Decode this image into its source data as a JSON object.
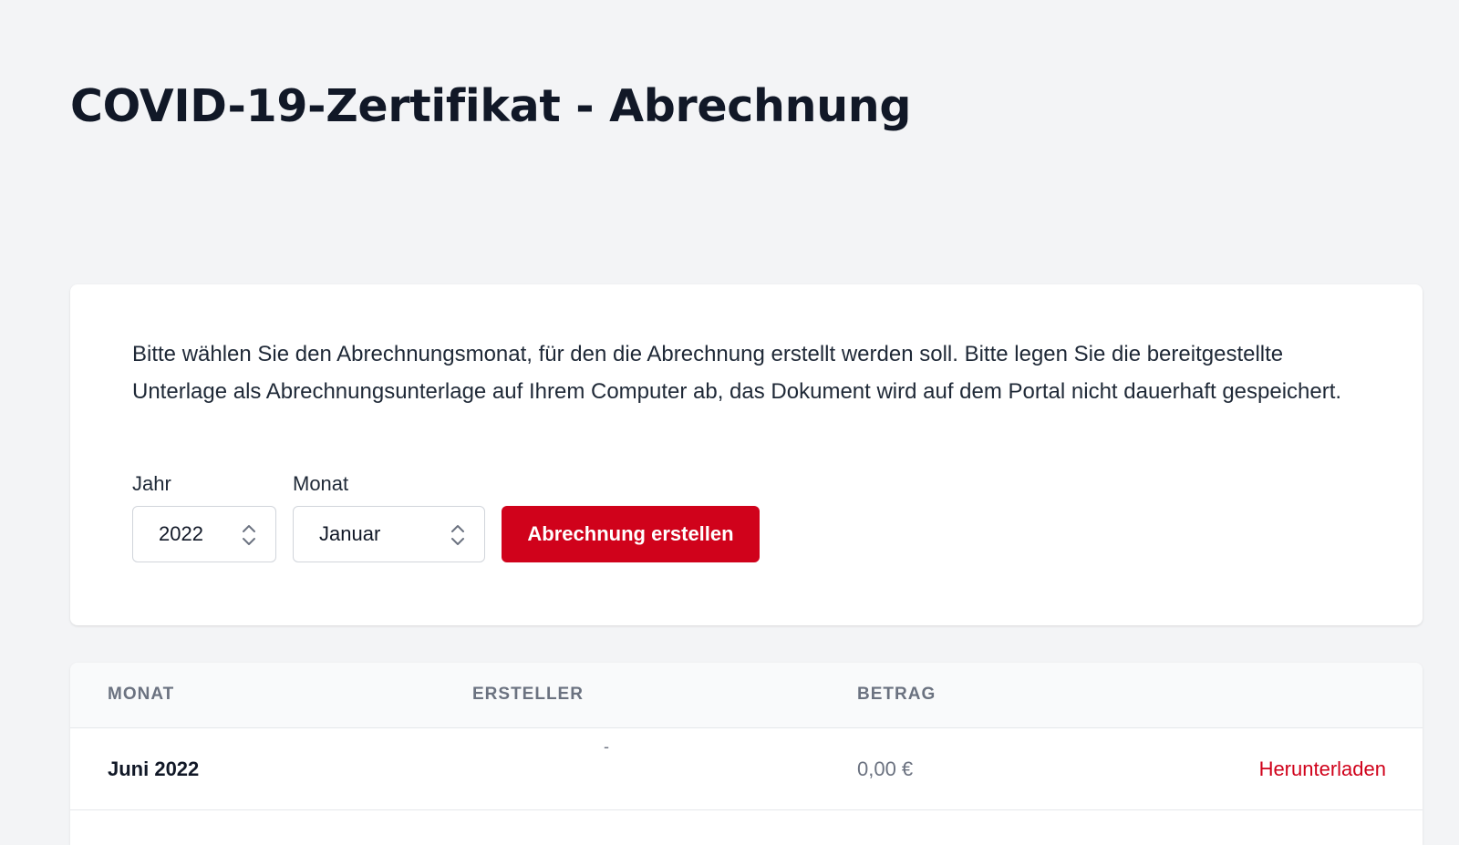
{
  "page": {
    "title": "COVID-19-Zertifikat - Abrechnung"
  },
  "form": {
    "intro_text": "Bitte wählen Sie den Abrechnungsmonat, für den die Abrechnung erstellt werden soll. Bitte legen Sie die bereitgestellte Unterlage als Abrechnungsunterlage auf Ihrem Computer ab, das Dokument wird auf dem Portal nicht dauerhaft gespeichert.",
    "year_label": "Jahr",
    "year_value": "2022",
    "month_label": "Monat",
    "month_value": "Januar",
    "submit_label": "Abrechnung erstellen"
  },
  "table": {
    "headers": [
      "MONAT",
      "ERSTELLER",
      "BETRAG"
    ],
    "rows": [
      {
        "month": "Juni 2022",
        "creator": "-",
        "amount": "0,00 €",
        "action": "Herunterladen"
      }
    ]
  },
  "colors": {
    "accent": "#d0021b",
    "background": "#f3f4f6"
  },
  "icons": {
    "select_chevron": "chevron-up-down-icon"
  }
}
